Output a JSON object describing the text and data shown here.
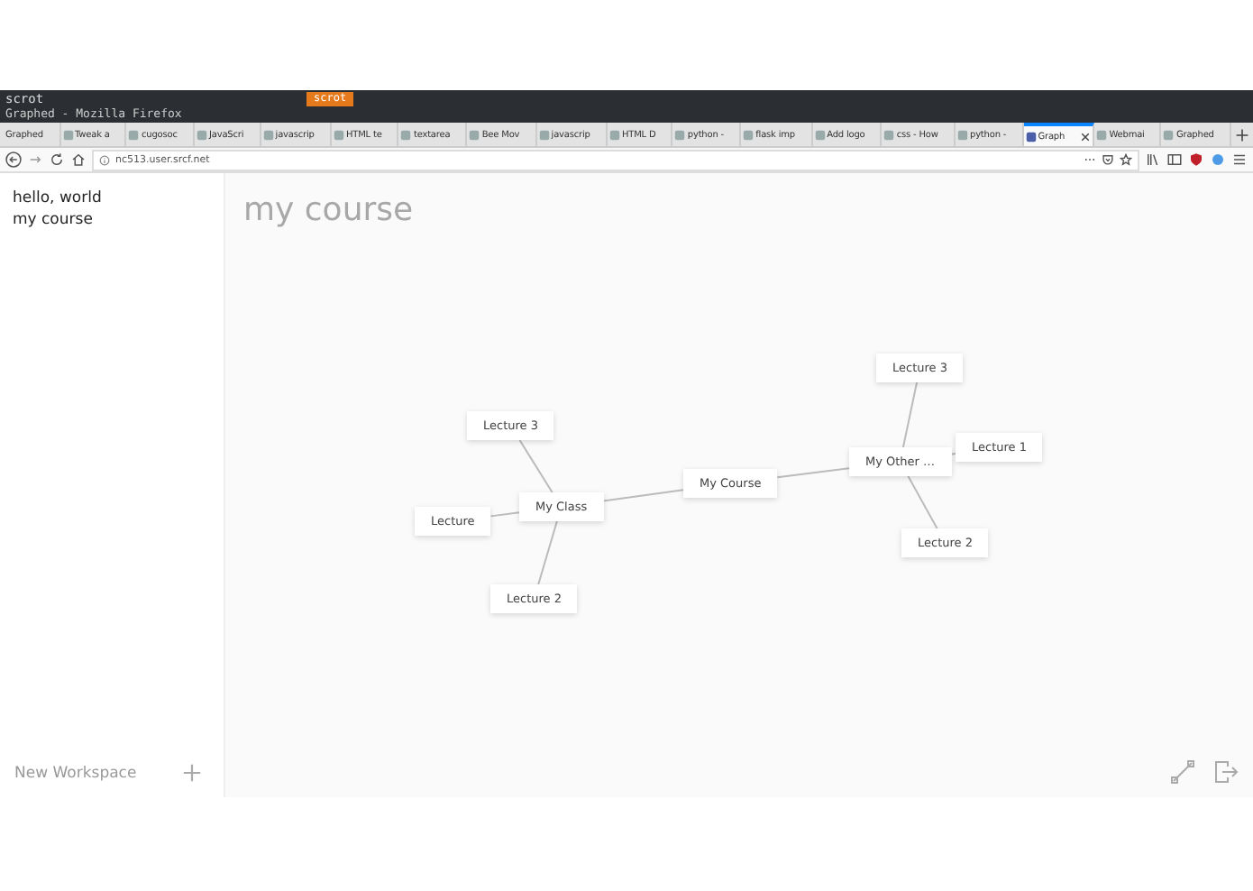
{
  "terminal": {
    "prompt": "scrot",
    "badge": "scrot"
  },
  "window": {
    "title": "Graphed - Mozilla Firefox"
  },
  "tabs": [
    {
      "label": "Graphed",
      "selected": false
    },
    {
      "label": "Tweak a",
      "selected": false
    },
    {
      "label": "cugosoc",
      "selected": false
    },
    {
      "label": "JavaScri",
      "selected": false
    },
    {
      "label": "javascrip",
      "selected": false
    },
    {
      "label": "HTML te",
      "selected": false
    },
    {
      "label": "textarea",
      "selected": false
    },
    {
      "label": "Bee Mov",
      "selected": false
    },
    {
      "label": "javascrip",
      "selected": false
    },
    {
      "label": "HTML D",
      "selected": false
    },
    {
      "label": "python -",
      "selected": false
    },
    {
      "label": "flask imp",
      "selected": false
    },
    {
      "label": "Add logo",
      "selected": false
    },
    {
      "label": "css - How",
      "selected": false
    },
    {
      "label": "python -",
      "selected": false
    },
    {
      "label": "Graph",
      "selected": true
    },
    {
      "label": "Webmai",
      "selected": false
    },
    {
      "label": "Graphed",
      "selected": false
    }
  ],
  "address": "nc513.user.srcf.net",
  "sidebar": {
    "items": [
      {
        "label": "hello, world",
        "selected": false
      },
      {
        "label": "my course",
        "selected": false
      }
    ],
    "new_workspace": "New Workspace"
  },
  "canvas": {
    "title": "my course",
    "graph": {
      "label": "My Course",
      "children": [
        {
          "label": "My Class",
          "children": [
            {
              "label": "Lecture 3"
            },
            {
              "label": "Lecture"
            },
            {
              "label": "Lecture 2"
            }
          ]
        },
        {
          "label": "My Other …",
          "children": [
            {
              "label": "Lecture 3"
            },
            {
              "label": "Lecture 1"
            },
            {
              "label": "Lecture 2"
            }
          ]
        }
      ]
    }
  }
}
